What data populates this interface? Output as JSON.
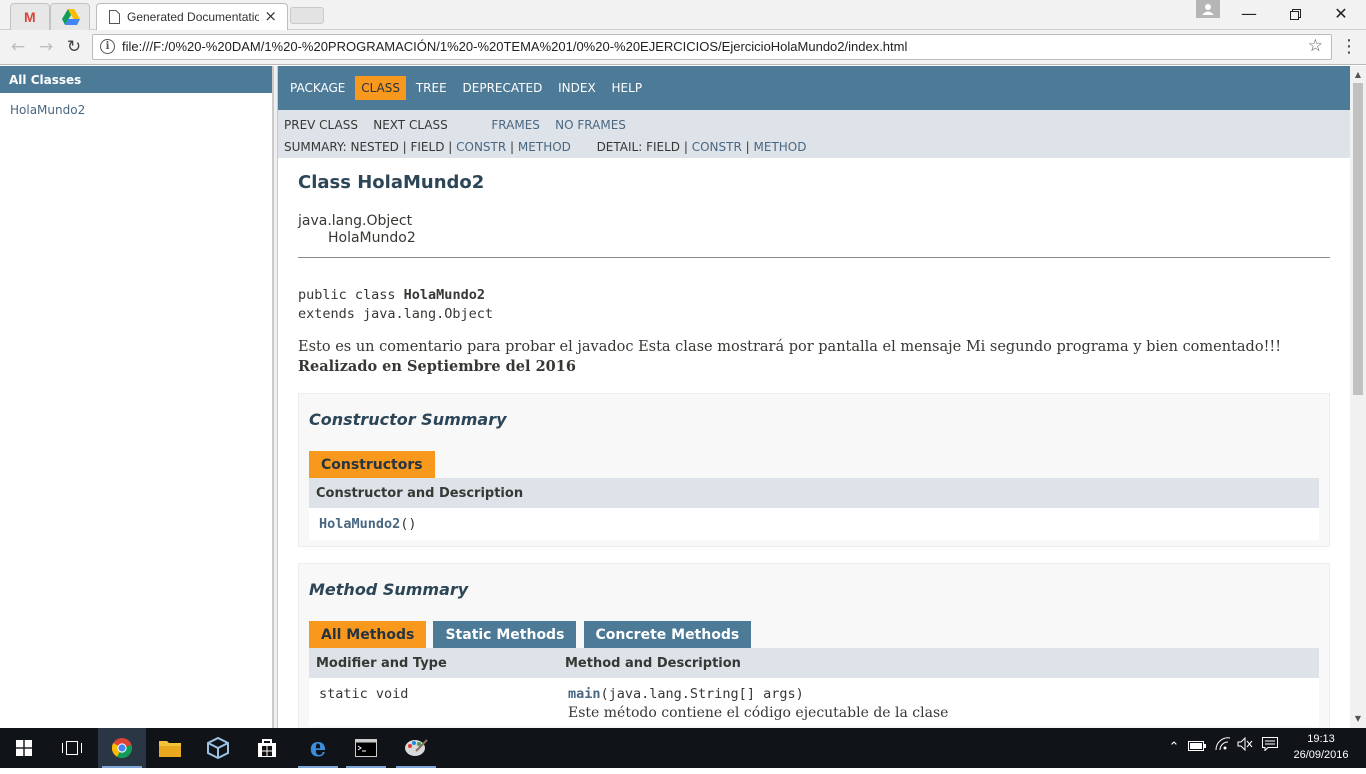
{
  "browser": {
    "tabs": [
      {
        "title": "",
        "icon": "gmail-icon"
      },
      {
        "title": "",
        "icon": "drive-icon"
      },
      {
        "title": "Generated Documentation (Untitled)",
        "icon": "page-icon"
      }
    ],
    "url": "file:///F:/0%20-%20DAM/1%20-%20PROGRAMACIÓN/1%20-%20TEMA%201/0%20-%20EJERCICIOS/EjercicioHolaMundo2/index.html"
  },
  "left_frame": {
    "header": "All Classes",
    "classes": [
      "HolaMundo2"
    ]
  },
  "topnav": {
    "items": [
      "PACKAGE",
      "CLASS",
      "TREE",
      "DEPRECATED",
      "INDEX",
      "HELP"
    ],
    "active": "CLASS"
  },
  "subnav": {
    "prev_class": "PREV CLASS",
    "next_class": "NEXT CLASS",
    "frames": "FRAMES",
    "no_frames": "NO FRAMES",
    "summary_label": "SUMMARY: NESTED | FIELD |",
    "summary_constr": "CONSTR",
    "summary_sep": "|",
    "summary_method": "METHOD",
    "detail_label": "DETAIL: FIELD |",
    "detail_constr": "CONSTR",
    "detail_sep": "|",
    "detail_method": "METHOD"
  },
  "class_page": {
    "title": "Class HolaMundo2",
    "inheritance": [
      "java.lang.Object",
      "HolaMundo2"
    ],
    "decl_prefix": "public class ",
    "decl_name": "HolaMundo2",
    "decl_extends": "extends java.lang.Object",
    "description": "Esto es un comentario para probar el javadoc Esta clase mostrará por pantalla el mensaje Mi segundo programa y bien comentado!!!",
    "description_bold": "Realizado en Septiembre del 2016"
  },
  "constructor_summary": {
    "heading": "Constructor Summary",
    "caption": "Constructors",
    "column": "Constructor and Description",
    "constructor_name": "HolaMundo2",
    "constructor_params": "()"
  },
  "method_summary": {
    "heading": "Method Summary",
    "captions": [
      "All Methods",
      "Static Methods",
      "Concrete Methods"
    ],
    "columns": [
      "Modifier and Type",
      "Method and Description"
    ],
    "rows": [
      {
        "modifier": "static void",
        "name": "main",
        "params": "(java.lang.String[] args)",
        "description": "Este método contiene el código ejecutable de la clase"
      }
    ]
  },
  "taskbar": {
    "time": "19:13",
    "date": "26/09/2016"
  }
}
